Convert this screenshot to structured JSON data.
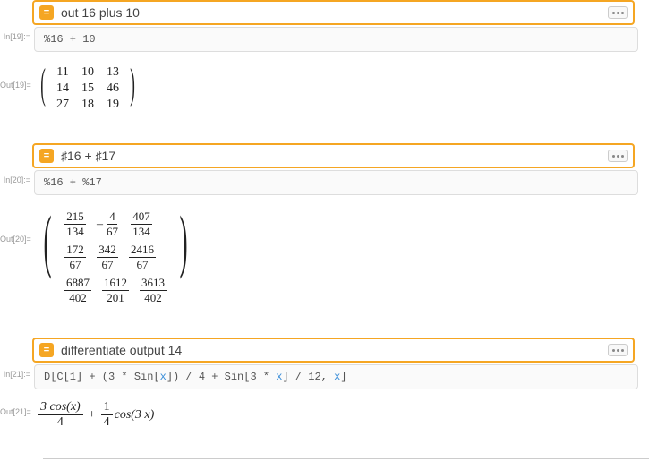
{
  "cells": {
    "c19": {
      "in_label": "In[19]:=",
      "out_label": "Out[19]=",
      "query": "out 16 plus 10",
      "code": "%16 + 10",
      "matrix": [
        [
          "11",
          "10",
          "13"
        ],
        [
          "14",
          "15",
          "46"
        ],
        [
          "27",
          "18",
          "19"
        ]
      ]
    },
    "c20": {
      "in_label": "In[20]:=",
      "out_label": "Out[20]=",
      "query": "♯16 + ♯17",
      "code": "%16 + %17",
      "matrix": [
        [
          {
            "n": "215",
            "d": "134"
          },
          {
            "neg": true,
            "n": "4",
            "d": "67"
          },
          {
            "n": "407",
            "d": "134"
          }
        ],
        [
          {
            "n": "172",
            "d": "67"
          },
          {
            "n": "342",
            "d": "67"
          },
          {
            "n": "2416",
            "d": "67"
          }
        ],
        [
          {
            "n": "6887",
            "d": "402"
          },
          {
            "n": "1612",
            "d": "201"
          },
          {
            "n": "3613",
            "d": "402"
          }
        ]
      ]
    },
    "c21": {
      "in_label": "In[21]:=",
      "out_label": "Out[21]=",
      "query": "differentiate output 14",
      "code_prefix": "D[C[1] + (3 * Sin[",
      "code_var1": "x",
      "code_mid1": "]) / 4 + Sin[3 * ",
      "code_var2": "x",
      "code_mid2": "] / 12, ",
      "code_var3": "x",
      "code_suffix": "]",
      "out_f1n": "3 cos(x)",
      "out_f1d": "4",
      "out_plus": "+",
      "out_f2n": "1",
      "out_f2d": "4",
      "out_tail": " cos(3 x)"
    }
  }
}
